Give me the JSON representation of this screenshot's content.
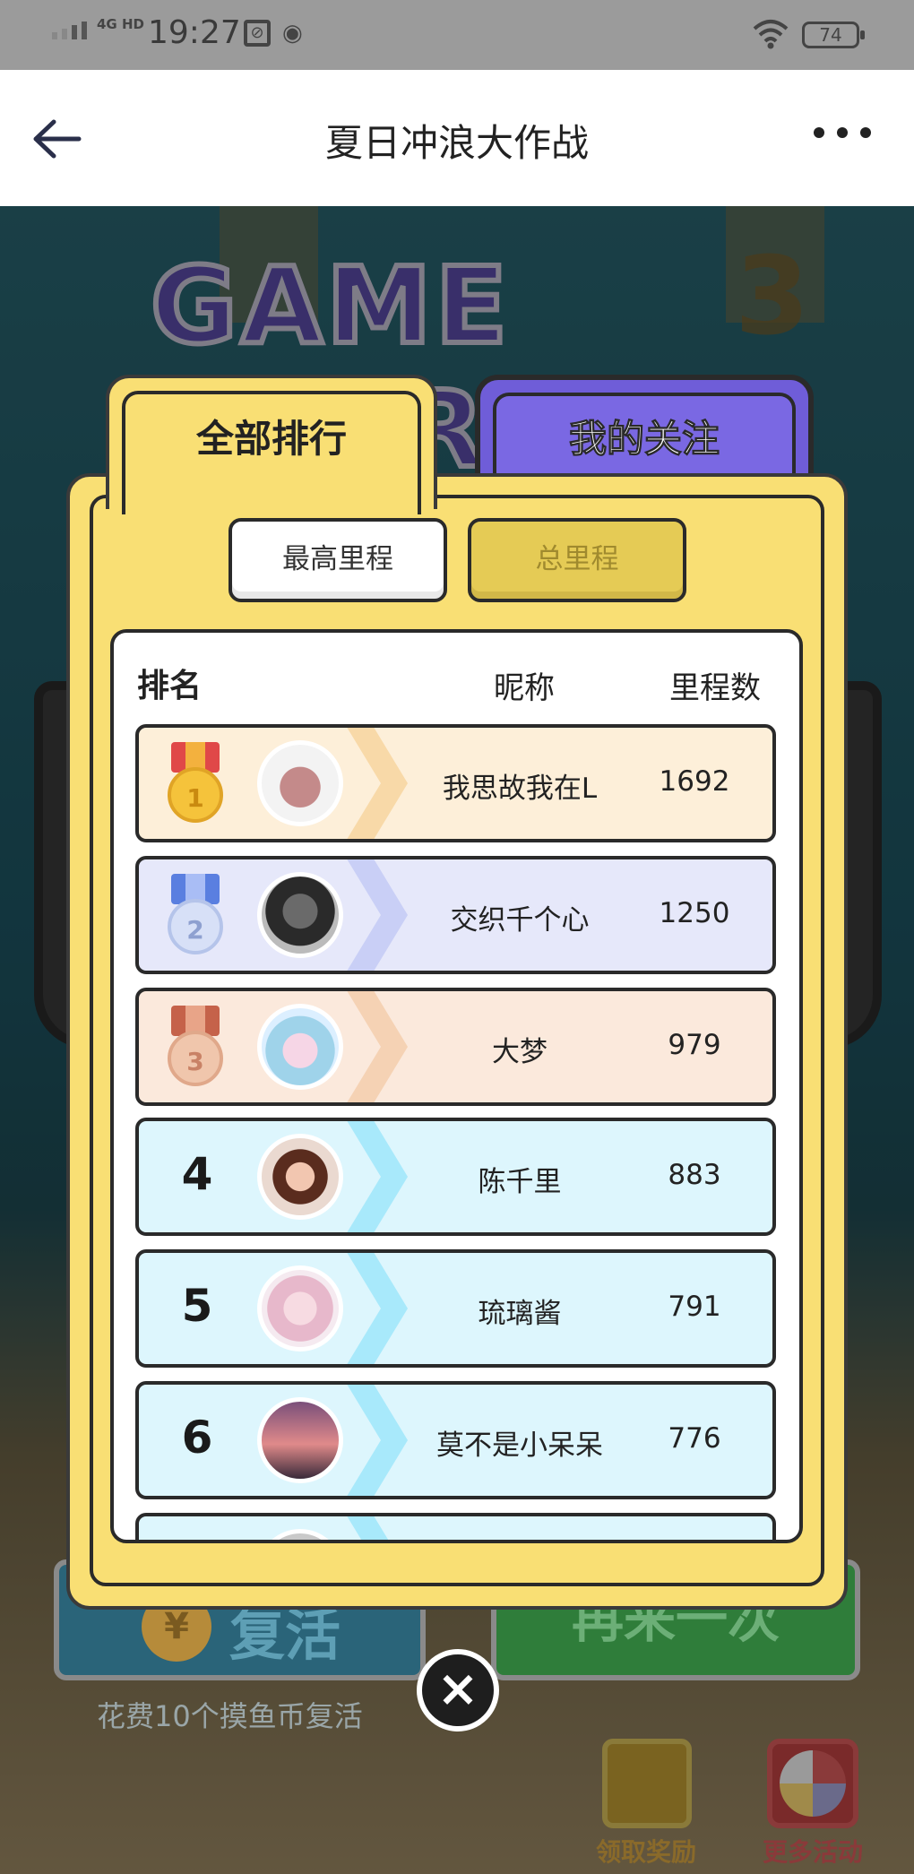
{
  "status_bar": {
    "network": "4G HD",
    "time": "19:27",
    "battery": "74"
  },
  "navbar": {
    "title": "夏日冲浪大作战"
  },
  "background": {
    "game_over_text": "GAME OVER",
    "game_over_number": "3"
  },
  "tabs": [
    {
      "label": "全部排行",
      "active": true
    },
    {
      "label": "我的关注",
      "active": false
    }
  ],
  "segments": [
    {
      "label": "最高里程",
      "active": true
    },
    {
      "label": "总里程",
      "active": false
    }
  ],
  "board": {
    "headers": {
      "rank": "排名",
      "nickname": "昵称",
      "distance": "里程数"
    },
    "rows": [
      {
        "rank": "1",
        "name": "我思故我在L",
        "distance": "1692"
      },
      {
        "rank": "2",
        "name": "交织千个心",
        "distance": "1250"
      },
      {
        "rank": "3",
        "name": "大梦",
        "distance": "979"
      },
      {
        "rank": "4",
        "name": "陈千里",
        "distance": "883"
      },
      {
        "rank": "5",
        "name": "琉璃酱",
        "distance": "791"
      },
      {
        "rank": "6",
        "name": "莫不是小呆呆",
        "distance": "776"
      }
    ]
  },
  "bottom": {
    "revive_label": "复活",
    "again_label": "再来一次",
    "revive_note": "花费10个摸鱼币复活",
    "gift_label": "领取奖励",
    "more_label": "更多活动"
  },
  "colors": {
    "panel": "#f9df74",
    "purple_tab": "#6f5dd8",
    "gold_row": "#fdefd9",
    "silver_row": "#e6e8fa",
    "bronze_row": "#fbe9dc",
    "blue_row": "#ddf6fd"
  }
}
